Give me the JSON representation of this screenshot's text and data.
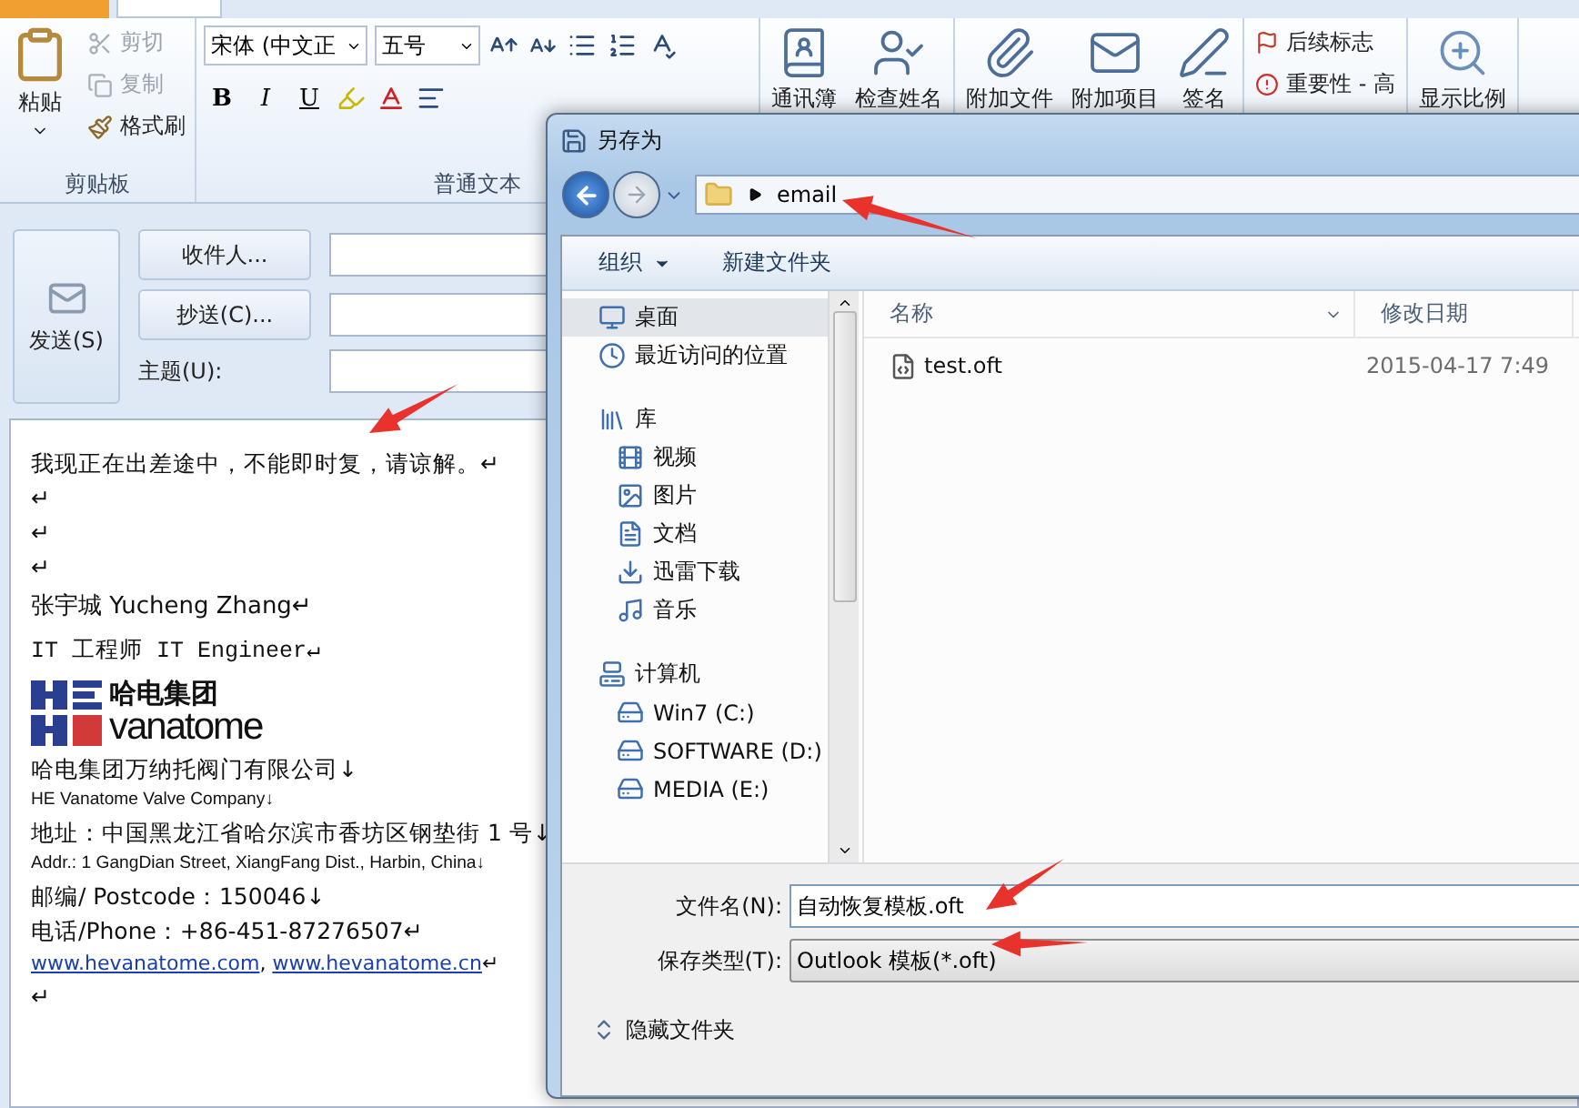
{
  "ribbon": {
    "clipboard": {
      "paste": "粘贴",
      "group": "剪贴板",
      "actions": [
        {
          "label": "剪切",
          "kind": "cut",
          "disabled": true
        },
        {
          "label": "复制",
          "kind": "copy",
          "disabled": true
        },
        {
          "label": "格式刷",
          "kind": "painter",
          "disabled": false
        }
      ]
    },
    "font": {
      "group": "普通文本",
      "font_name": "宋体 (中文正",
      "font_size": "五号",
      "format_buttons": [
        {
          "label": "B",
          "kind": "bold"
        },
        {
          "label": "I",
          "kind": "italic"
        },
        {
          "label": "U",
          "kind": "underline"
        }
      ]
    },
    "command_groups": [
      [
        {
          "label": "通讯簿",
          "kind": "address-book"
        },
        {
          "label": "检查姓名",
          "kind": "check-names"
        }
      ],
      [
        {
          "label": "附加文件",
          "kind": "attach-file"
        },
        {
          "label": "附加项目",
          "kind": "attach-item"
        },
        {
          "label": "签名",
          "kind": "signature"
        }
      ]
    ],
    "tags": [
      {
        "label": "后续标志",
        "kind": "flag"
      },
      {
        "label": "重要性 - 高",
        "kind": "importance"
      }
    ],
    "zoom": "显示比例"
  },
  "message": {
    "send": "发送(S)",
    "to_button": "收件人...",
    "cc_button": "抄送(C)...",
    "subject_label": "主题(U):"
  },
  "body": [
    {
      "kind": "text",
      "text": "我现正在出差途中，不能即时复，请谅解。↵"
    },
    {
      "kind": "text",
      "text": "↵"
    },
    {
      "kind": "text",
      "text": "↵"
    },
    {
      "kind": "text",
      "text": "↵"
    },
    {
      "kind": "name",
      "text": "张宇城  Yucheng Zhang↵"
    },
    {
      "kind": "mono",
      "text": "IT 工程师 IT Engineer↵"
    },
    {
      "kind": "logo",
      "text": "哈电集团",
      "subtext": "vanatome"
    },
    {
      "kind": "text",
      "text": "哈电集团万纳托阀门有限公司↓"
    },
    {
      "kind": "small",
      "text": "HE Vanatome Valve Company↓"
    },
    {
      "kind": "text",
      "text": "地址：中国黑龙江省哈尔滨市香坊区钢垫街 1 号↓"
    },
    {
      "kind": "small",
      "text": "Addr.: 1 GangDian Street, XiangFang Dist., Harbin, China↓"
    },
    {
      "kind": "text",
      "text": "邮编/ Postcode：150046↓"
    },
    {
      "kind": "text",
      "text": "电话/Phone：+86-451-87276507↵"
    },
    {
      "kind": "links",
      "links": [
        "www.hevanatome.com",
        "www.hevanatome.cn"
      ],
      "separator": ",",
      "end": "↵"
    },
    {
      "kind": "text",
      "text": "↵"
    }
  ],
  "dialog": {
    "title": "另存为",
    "path": "email",
    "toolbar": [
      {
        "label": "组织",
        "dropdown": true
      },
      {
        "label": "新建文件夹",
        "dropdown": false
      }
    ],
    "nav": [
      {
        "label": "桌面",
        "kind": "desktop",
        "selected": true
      },
      {
        "label": "最近访问的位置",
        "kind": "recent",
        "selected": false
      },
      {
        "label": "库",
        "kind": "library",
        "selected": false,
        "children": [
          {
            "label": "视频",
            "kind": "video",
            "selected": false
          },
          {
            "label": "图片",
            "kind": "pictures",
            "selected": false
          },
          {
            "label": "文档",
            "kind": "documents",
            "selected": false
          },
          {
            "label": "迅雷下载",
            "kind": "download",
            "selected": false
          },
          {
            "label": "音乐",
            "kind": "music",
            "selected": false
          }
        ]
      },
      {
        "label": "计算机",
        "kind": "computer",
        "selected": false,
        "children": [
          {
            "label": "Win7 (C:)",
            "kind": "drive",
            "selected": false
          },
          {
            "label": "SOFTWARE (D:)",
            "kind": "drive",
            "selected": false
          },
          {
            "label": "MEDIA (E:)",
            "kind": "drive",
            "selected": false
          }
        ]
      }
    ],
    "columns": [
      "名称",
      "修改日期"
    ],
    "files": [
      {
        "name": "test.oft",
        "modified": "2015-04-17 7:49"
      }
    ],
    "filename_label": "文件名(N):",
    "filename": "自动恢复模板.oft",
    "type_label": "保存类型(T):",
    "type": "Outlook 模板(*.oft)",
    "hide_folders": "隐藏文件夹"
  }
}
